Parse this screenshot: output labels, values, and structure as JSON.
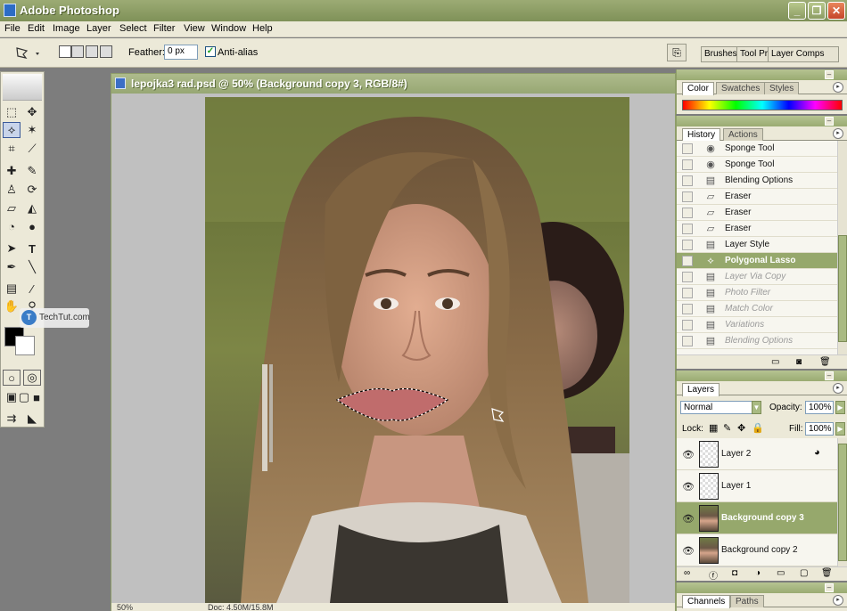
{
  "app": {
    "title": "Adobe Photoshop"
  },
  "window_buttons": {
    "minimize": "_",
    "maximize": "❐",
    "close": "✕"
  },
  "menu": [
    "File",
    "Edit",
    "Image",
    "Layer",
    "Select",
    "Filter",
    "View",
    "Window",
    "Help"
  ],
  "options": {
    "feather_label": "Feather:",
    "feather_value": "0 px",
    "antialias_label": "Anti-alias",
    "antialias_checked": true
  },
  "palette_well": [
    "Brushes",
    "Tool Pr",
    "Layer Comps"
  ],
  "watermark": {
    "logo": "T",
    "text": "TechTut.com"
  },
  "document": {
    "title": "lepojka3 rad.psd @ 50% (Background copy 3, RGB/8#)",
    "zoom": "50%",
    "doc_info": "Doc: 4.50M/15.8M"
  },
  "color_palette": {
    "tabs": [
      "Color",
      "Swatches",
      "Styles"
    ],
    "active_tab": "Color"
  },
  "history_palette": {
    "tabs": [
      "History",
      "Actions"
    ],
    "active_tab": "History",
    "items": [
      {
        "label": "Sponge Tool",
        "icon": "sponge-icon",
        "state": "normal"
      },
      {
        "label": "Sponge Tool",
        "icon": "sponge-icon",
        "state": "normal"
      },
      {
        "label": "Blending Options",
        "icon": "document-icon",
        "state": "normal"
      },
      {
        "label": "Eraser",
        "icon": "eraser-icon",
        "state": "normal"
      },
      {
        "label": "Eraser",
        "icon": "eraser-icon",
        "state": "normal"
      },
      {
        "label": "Eraser",
        "icon": "eraser-icon",
        "state": "normal"
      },
      {
        "label": "Layer Style",
        "icon": "document-icon",
        "state": "normal"
      },
      {
        "label": "Polygonal Lasso",
        "icon": "polygonal-lasso-icon",
        "state": "active"
      },
      {
        "label": "Layer Via Copy",
        "icon": "document-icon",
        "state": "future"
      },
      {
        "label": "Photo Filter",
        "icon": "document-icon",
        "state": "future"
      },
      {
        "label": "Match Color",
        "icon": "document-icon",
        "state": "future"
      },
      {
        "label": "Variations",
        "icon": "document-icon",
        "state": "future"
      },
      {
        "label": "Blending Options",
        "icon": "document-icon",
        "state": "future"
      }
    ]
  },
  "layers_palette": {
    "tabs": [
      "Layers"
    ],
    "blend_mode": "Normal",
    "opacity_label": "Opacity:",
    "opacity_value": "100%",
    "lock_label": "Lock:",
    "fill_label": "Fill:",
    "fill_value": "100%",
    "layers": [
      {
        "name": "Layer 2",
        "thumb": "transparent",
        "active": false
      },
      {
        "name": "Layer 1",
        "thumb": "transparent",
        "active": false
      },
      {
        "name": "Background copy 3",
        "thumb": "photo",
        "active": true
      },
      {
        "name": "Background copy 2",
        "thumb": "photo",
        "active": false
      }
    ]
  },
  "channels_palette": {
    "tabs": [
      "Channels",
      "Paths"
    ],
    "active_tab": "Channels"
  },
  "colors": {
    "accent": "#96a86c",
    "title_bar": "#8fa062",
    "panel_bg": "#ece9d8"
  }
}
